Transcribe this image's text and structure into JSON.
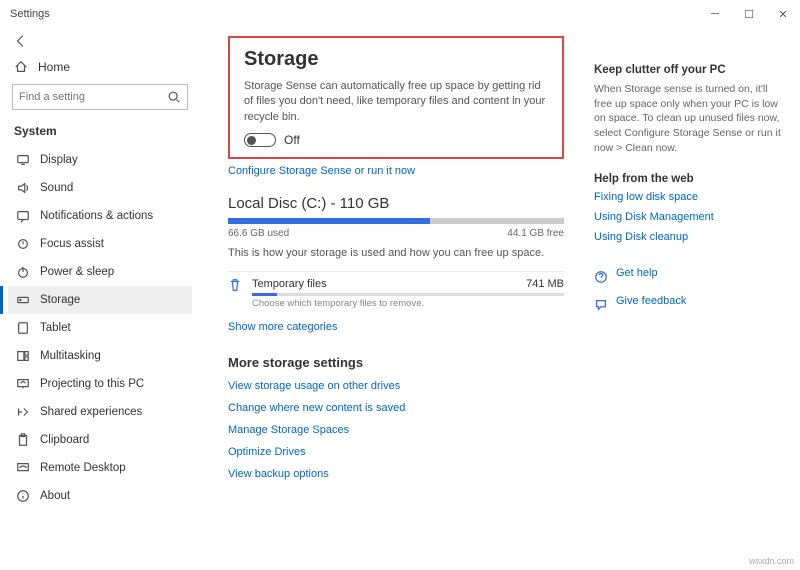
{
  "titlebar": {
    "title": "Settings"
  },
  "sidebar": {
    "home": "Home",
    "search_placeholder": "Find a setting",
    "section": "System",
    "items": [
      {
        "label": "Display"
      },
      {
        "label": "Sound"
      },
      {
        "label": "Notifications & actions"
      },
      {
        "label": "Focus assist"
      },
      {
        "label": "Power & sleep"
      },
      {
        "label": "Storage"
      },
      {
        "label": "Tablet"
      },
      {
        "label": "Multitasking"
      },
      {
        "label": "Projecting to this PC"
      },
      {
        "label": "Shared experiences"
      },
      {
        "label": "Clipboard"
      },
      {
        "label": "Remote Desktop"
      },
      {
        "label": "About"
      }
    ]
  },
  "main": {
    "title": "Storage",
    "description": "Storage Sense can automatically free up space by getting rid of files you don't need, like temporary files and content in your recycle bin.",
    "toggle_label": "Off",
    "configure_link": "Configure Storage Sense or run it now",
    "disk_heading": "Local Disc (C:) - 110 GB",
    "used": "66.6 GB used",
    "free": "44.1 GB free",
    "fill_pct": 60,
    "usage_desc": "This is how your storage is used and how you can free up space.",
    "temp": {
      "label": "Temporary files",
      "size": "741 MB",
      "hint": "Choose which temporary files to remove."
    },
    "show_more": "Show more categories",
    "more_heading": "More storage settings",
    "more_links": [
      "View storage usage on other drives",
      "Change where new content is saved",
      "Manage Storage Spaces",
      "Optimize Drives",
      "View backup options"
    ]
  },
  "aside": {
    "h1": "Keep clutter off your PC",
    "p1": "When Storage sense is turned on, it'll free up space only when your PC is low on space. To clean up unused files now, select Configure Storage Sense or run it now > Clean now.",
    "h2": "Help from the web",
    "links": [
      "Fixing low disk space",
      "Using Disk Management",
      "Using Disk cleanup"
    ],
    "get_help": "Get help",
    "feedback": "Give feedback"
  },
  "watermark": "wsxdn.com"
}
